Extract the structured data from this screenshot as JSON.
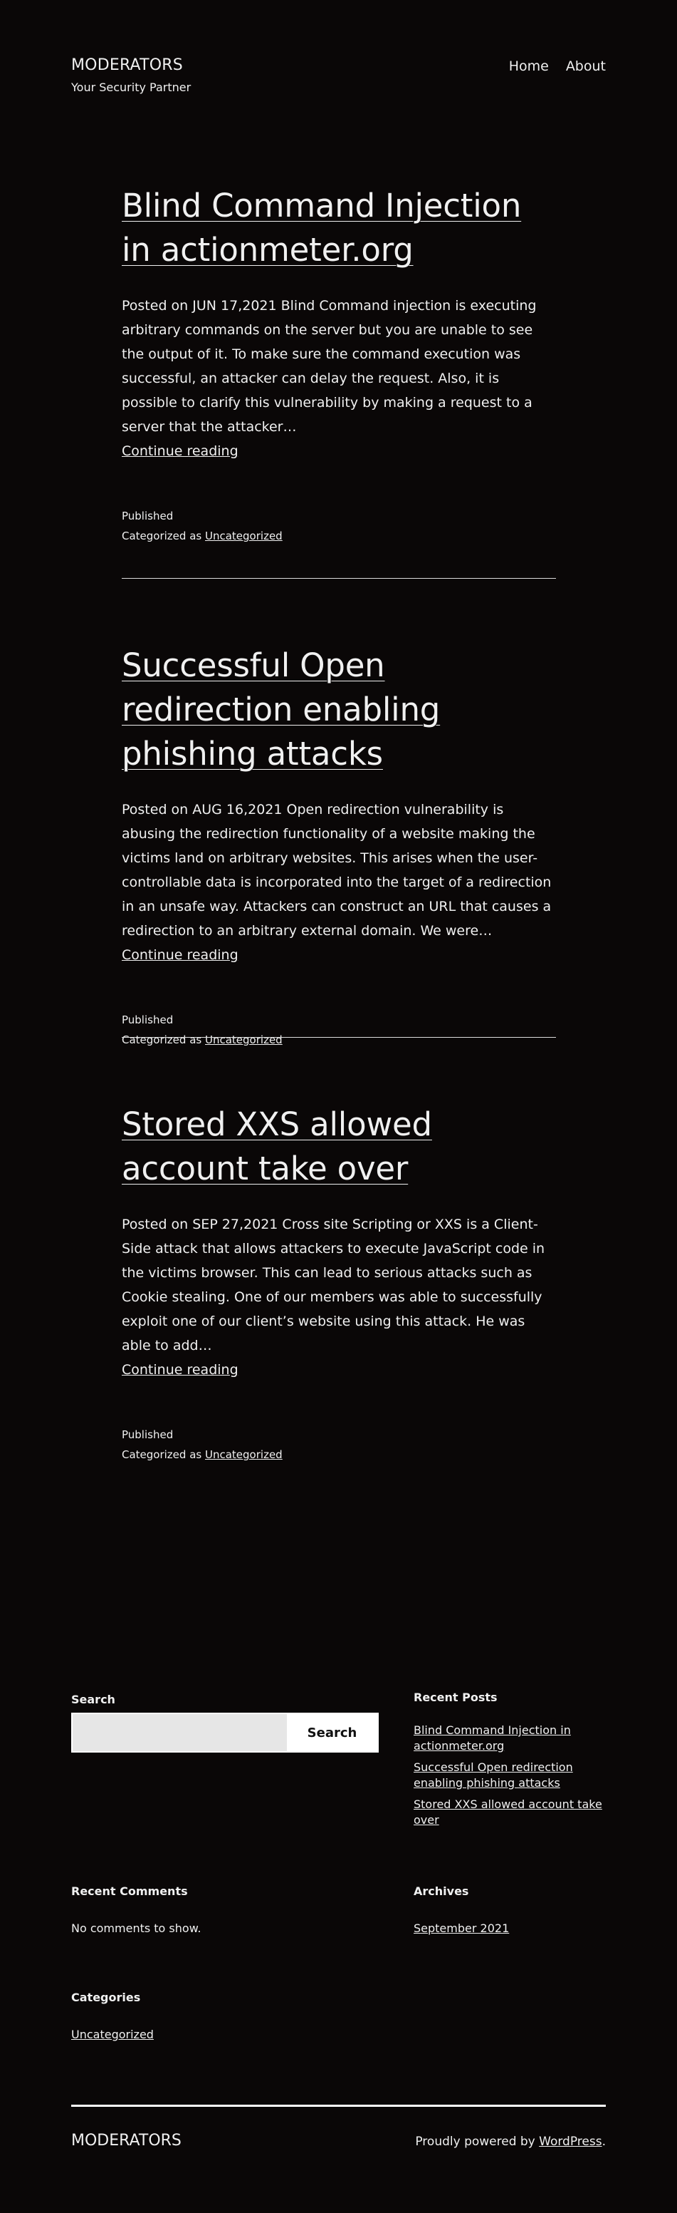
{
  "header": {
    "site_title": "MODERATORS",
    "tagline": "Your Security Partner",
    "nav": [
      {
        "label": "Home"
      },
      {
        "label": "About"
      }
    ]
  },
  "posts": [
    {
      "title": "Blind Command Injection in actionmeter.org",
      "excerpt": "Posted on JUN 17,2021 Blind Command injection is executing arbitrary commands on the server but you are unable to see the output of it. To make sure the command execution was successful, an attacker can delay the request. Also, it is possible to clarify this vulnerability by making a request to a server that the attacker…",
      "continue_label": "Continue reading",
      "published_label": "Published",
      "categorized_prefix": "Categorized as",
      "category": "Uncategorized"
    },
    {
      "title": "Successful Open redirection enabling phishing attacks",
      "excerpt": "Posted on AUG 16,2021 Open redirection vulnerability is abusing the redirection functionality of a website making the victims land on arbitrary websites. This arises when the user-controllable data is incorporated into the target of a redirection in an unsafe way. Attackers can construct an URL that causes a redirection to an arbitrary external domain. We were…",
      "continue_label": "Continue reading",
      "published_label": "Published",
      "categorized_prefix": "Categorized as",
      "category": "Uncategorized"
    },
    {
      "title": "Stored XXS allowed account take over",
      "excerpt": "Posted on SEP 27,2021 Cross site Scripting or XXS is a Client-Side attack that allows attackers to execute JavaScript code in the victims browser. This can lead to serious attacks such as Cookie stealing. One of our members was able to successfully exploit one of our client’s website using this attack. He was able to add…",
      "continue_label": "Continue reading",
      "published_label": "Published",
      "categorized_prefix": "Categorized as",
      "category": "Uncategorized"
    }
  ],
  "widgets": {
    "search": {
      "title": "Search",
      "placeholder": "",
      "button_label": "Search"
    },
    "recent_posts": {
      "title": "Recent Posts",
      "items": [
        "Blind Command Injection in actionmeter.org",
        "Successful Open redirection enabling phishing attacks",
        "Stored XXS allowed account take over"
      ]
    },
    "recent_comments": {
      "title": "Recent Comments",
      "text": "No comments to show."
    },
    "archives": {
      "title": "Archives",
      "items": [
        "September 2021"
      ]
    },
    "categories": {
      "title": "Categories",
      "items": [
        "Uncategorized"
      ]
    }
  },
  "footer": {
    "site_title": "MODERATORS",
    "credit_prefix": "Proudly powered by",
    "credit_link": "WordPress",
    "credit_suffix": "."
  }
}
